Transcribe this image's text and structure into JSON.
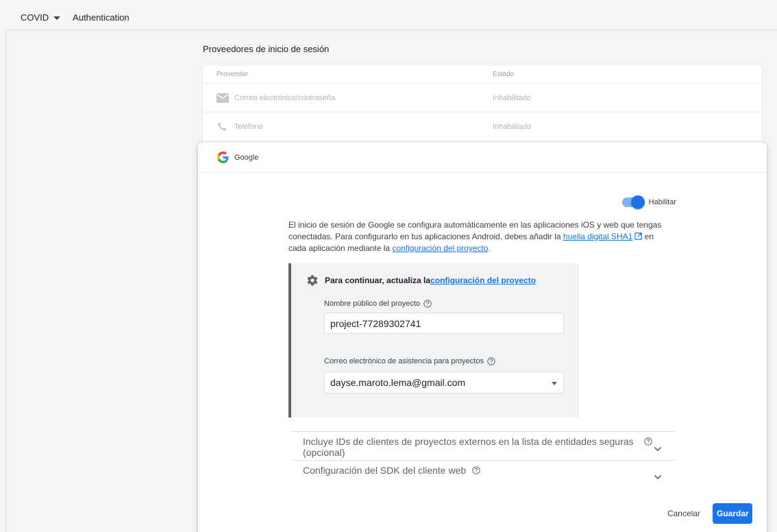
{
  "topbar": {
    "project": "COVID",
    "section": "Authentication"
  },
  "providers": {
    "title": "Proveedores de inicio de sesión",
    "columns": {
      "provider": "Proveedor",
      "status": "Estado"
    },
    "rows": [
      {
        "name": "Correo electrónico/contraseña",
        "status": "Inhabilitado",
        "icon": "email-icon"
      },
      {
        "name": "Teléfono",
        "status": "Inhabilitado",
        "icon": "phone-icon"
      }
    ]
  },
  "google_panel": {
    "title": "Google",
    "enable_label": "Habilitar",
    "enabled": true,
    "description": {
      "part1": "El inicio de sesión de Google se configura automáticamente en las aplicaciones iOS y web que tengas conectadas. Para configurarlo en tus aplicaciones Android, debes añadir la ",
      "link1": "huella digital SHA1",
      "part2": " en cada aplicación mediante la ",
      "link2": "configuración del proyecto",
      "part3": "."
    },
    "note": {
      "prefix": "Para continuar, actualiza la ",
      "link": "configuración del proyecto",
      "public_name_label": "Nombre público del proyecto",
      "public_name_value": "project-77289302741",
      "support_email_label": "Correo electrónico de asistencia para proyectos",
      "support_email_value": "dayse.maroto.lema@gmail.com"
    },
    "accordions": [
      {
        "line1": "Incluye IDs de clientes de proyectos externos en la lista de entidades seguras",
        "line2": "(opcional)"
      },
      {
        "line1": "Configuración del SDK del cliente web"
      }
    ],
    "buttons": {
      "cancel": "Cancelar",
      "save": "Guardar"
    }
  },
  "colors": {
    "primary": "#1a73e8",
    "toggle_track": "#80b1f0",
    "note_bg": "#f1f3f4",
    "note_border": "#5f6368"
  }
}
